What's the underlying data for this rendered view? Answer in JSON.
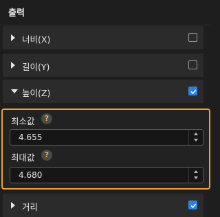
{
  "header": {
    "title": "출력"
  },
  "outputs": [
    {
      "label": "너비(X)",
      "checked": false,
      "expanded": false
    },
    {
      "label": "길이(Y)",
      "checked": false,
      "expanded": false
    },
    {
      "label": "높이(Z)",
      "checked": true,
      "expanded": true
    },
    {
      "label": "거리",
      "checked": true,
      "expanded": false
    }
  ],
  "height_range": {
    "min_label": "최소값",
    "min_value": "4.655",
    "max_label": "최대값",
    "max_value": "4.680",
    "help_glyph": "?"
  },
  "colors": {
    "highlight_border": "#f0a030",
    "checkbox_checked": "#2a82e4",
    "help_question": "#e0b44a"
  },
  "icons": {
    "collapsed": "caret-right-icon",
    "expanded": "caret-down-icon",
    "help": "question-circle-icon",
    "spin_up": "chevron-up-icon",
    "spin_down": "chevron-down-icon",
    "checkmark": "checkmark-icon"
  }
}
